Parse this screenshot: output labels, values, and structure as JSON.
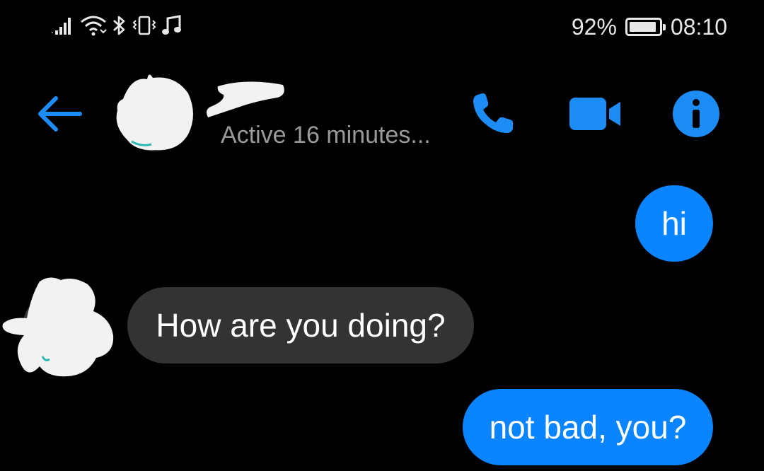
{
  "status_bar": {
    "battery_text": "92%",
    "battery_level": 0.92,
    "time": "08:10",
    "icons": [
      "signal-icon",
      "wifi-icon",
      "bluetooth-icon",
      "vibrate-icon",
      "music-note-icon",
      "battery-icon"
    ]
  },
  "header": {
    "active_status": "Active 16 minutes...",
    "actions": [
      "back-arrow-icon",
      "phone-icon",
      "video-camera-icon",
      "info-icon"
    ]
  },
  "colors": {
    "accent": "#0a84ff",
    "background": "#000000",
    "incoming_bubble": "#333333",
    "secondary_text": "#9a9a9a"
  },
  "messages": [
    {
      "direction": "outgoing",
      "text": "hi"
    },
    {
      "direction": "incoming",
      "text": "How are you doing?"
    },
    {
      "direction": "outgoing",
      "text": "not bad, you?"
    }
  ]
}
